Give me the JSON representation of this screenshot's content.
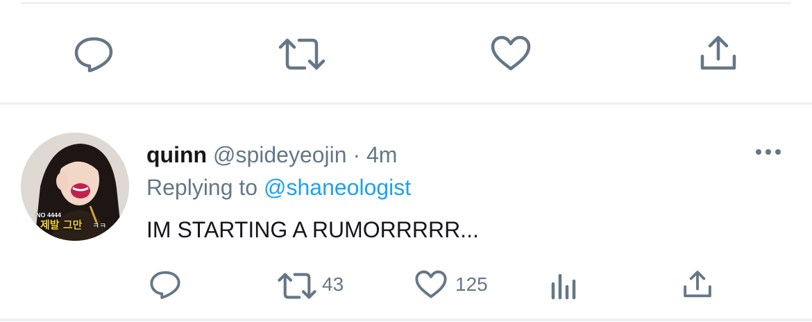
{
  "top_bar": {
    "icons": [
      "reply-icon",
      "retweet-icon",
      "like-icon",
      "share-icon"
    ]
  },
  "tweet": {
    "display_name": "quinn",
    "handle": "@spideyeojin",
    "separator": "·",
    "time": "4m",
    "reply_prefix": "Replying to",
    "reply_to": "@shaneologist",
    "text": "IM STARTING A RUMORRRRR...",
    "avatar_caption": "제발 그만",
    "avatar_caption_small": "NO 4444",
    "avatar_caption_suffix": "ㅋㅋ",
    "retweet_count": "43",
    "like_count": "125"
  },
  "colors": {
    "icon_gray": "#657786",
    "link_blue": "#1da1f2",
    "text_dark": "#14171a",
    "divider": "#eff1f3"
  }
}
